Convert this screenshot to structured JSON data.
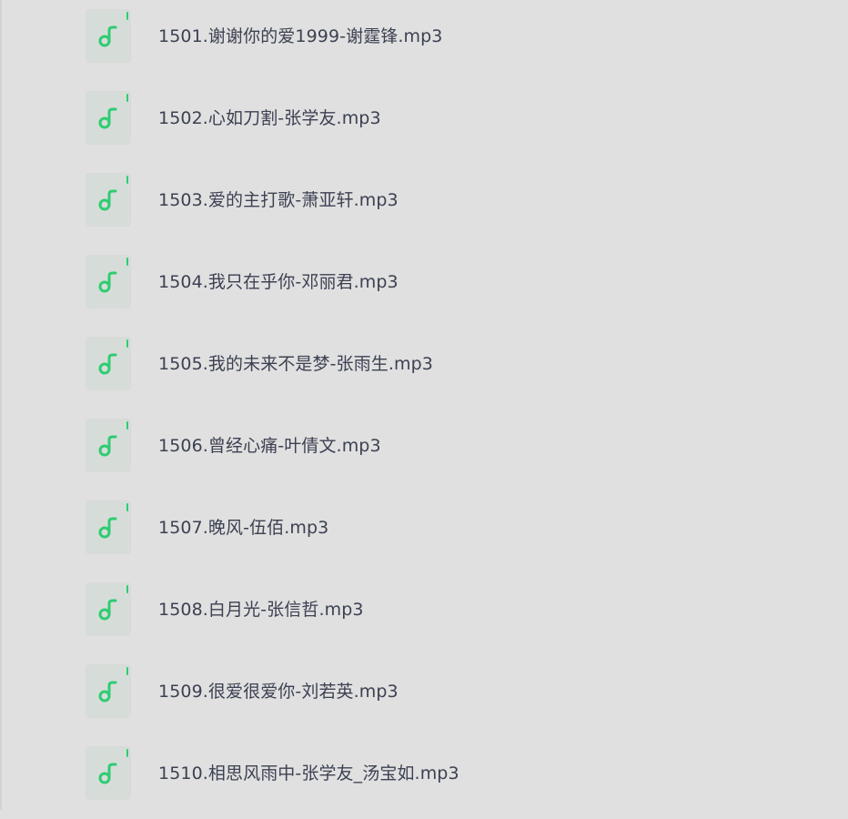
{
  "file_list": {
    "icon": "music-note-icon",
    "accent_color": "#2ecc71",
    "items": [
      {
        "name": "1501.谢谢你的爱1999-谢霆锋.mp3"
      },
      {
        "name": "1502.心如刀割-张学友.mp3"
      },
      {
        "name": "1503.爱的主打歌-萧亚轩.mp3"
      },
      {
        "name": "1504.我只在乎你-邓丽君.mp3"
      },
      {
        "name": "1505.我的未来不是梦-张雨生.mp3"
      },
      {
        "name": "1506.曾经心痛-叶倩文.mp3"
      },
      {
        "name": "1507.晚风-伍佰.mp3"
      },
      {
        "name": "1508.白月光-张信哲.mp3"
      },
      {
        "name": "1509.很爱很爱你-刘若英.mp3"
      },
      {
        "name": "1510.相思风雨中-张学友_汤宝如.mp3"
      }
    ]
  }
}
